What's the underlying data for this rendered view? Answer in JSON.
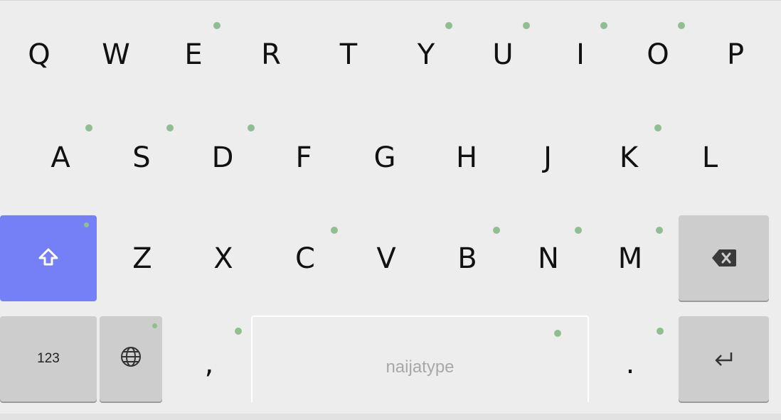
{
  "keyboard": {
    "row1": [
      "Q",
      "W",
      "E",
      "R",
      "T",
      "Y",
      "U",
      "I",
      "O",
      "P"
    ],
    "row2": [
      "A",
      "S",
      "D",
      "F",
      "G",
      "H",
      "J",
      "K",
      "L"
    ],
    "row3": [
      "Z",
      "X",
      "C",
      "V",
      "B",
      "N",
      "M"
    ],
    "numbers_label": "123",
    "comma_label": ",",
    "period_label": ".",
    "space_label": "naijatype",
    "shift_icon": "shift-arrow-icon",
    "backspace_icon": "backspace-icon",
    "globe_icon": "globe-icon",
    "enter_icon": "enter-icon",
    "colors": {
      "background": "#ededed",
      "shift_active": "#7680f6",
      "function_key": "#cdcdcd",
      "accent_dot": "#8fbf8f"
    }
  }
}
